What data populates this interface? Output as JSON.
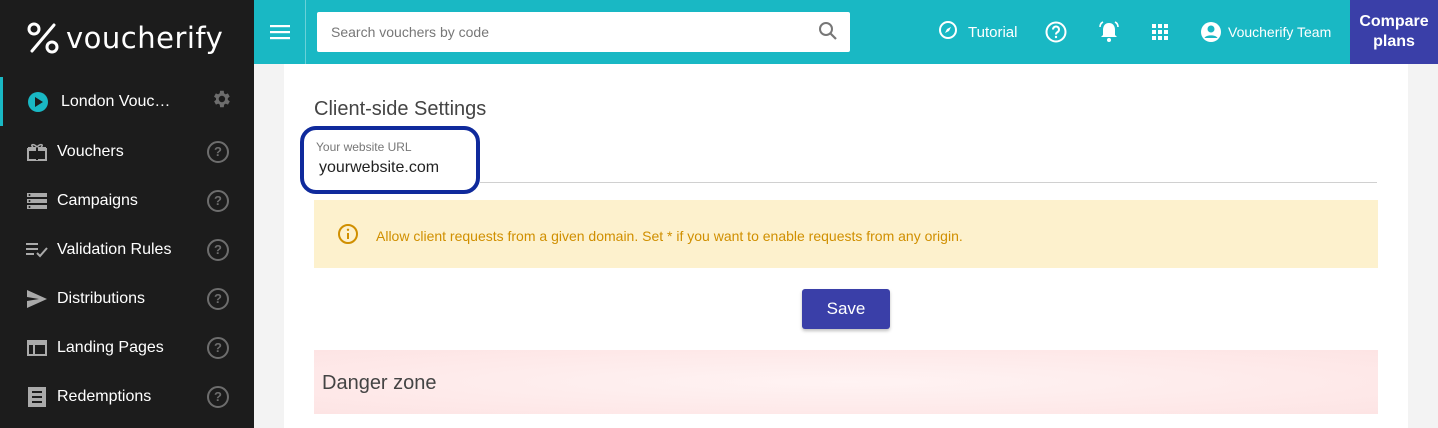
{
  "app": {
    "logo_text": "voucherify"
  },
  "sidebar": {
    "project": {
      "label": "London Vouc…"
    },
    "items": [
      {
        "label": "Vouchers",
        "icon": "gift-icon"
      },
      {
        "label": "Campaigns",
        "icon": "campaigns-icon"
      },
      {
        "label": "Validation Rules",
        "icon": "validation-rules-icon"
      },
      {
        "label": "Distributions",
        "icon": "send-icon"
      },
      {
        "label": "Landing Pages",
        "icon": "landing-page-icon"
      },
      {
        "label": "Redemptions",
        "icon": "redemptions-icon"
      }
    ],
    "help_glyph": "?"
  },
  "topbar": {
    "search_placeholder": "Search vouchers by code",
    "tutorial_label": "Tutorial",
    "user_label": "Voucherify Team",
    "compare_label": "Compare plans"
  },
  "main": {
    "section_title": "Client-side Settings",
    "url_field": {
      "label": "Your website URL",
      "value": "yourwebsite.com"
    },
    "warning_text": "Allow client requests from a given domain. Set * if you want to enable requests from any origin.",
    "save_label": "Save",
    "danger_title": "Danger zone"
  },
  "colors": {
    "sidebar_bg": "#1c1c1c",
    "topbar_bg": "#19b8c4",
    "accent": "#3a3fa8",
    "warning_bg": "#fdf1cd",
    "warning_text": "#d08f00",
    "highlight_border": "#0f2a9c"
  }
}
